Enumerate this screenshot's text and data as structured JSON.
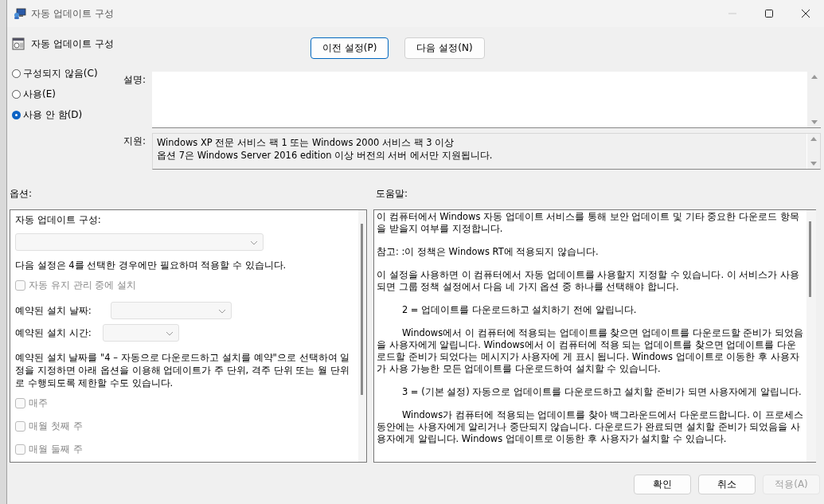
{
  "window": {
    "title": "자동 업데이트 구성",
    "controls": [
      {
        "kind": "minimize",
        "disabled": true
      },
      {
        "kind": "maximize",
        "disabled": false
      },
      {
        "kind": "close",
        "disabled": false
      }
    ]
  },
  "header": {
    "title": "자동 업데이트 구성"
  },
  "nav_buttons": [
    {
      "label": "이전 설정(P)",
      "focused": true
    },
    {
      "label": "다음 설정(N)",
      "focused": false
    }
  ],
  "state_options": [
    {
      "label": "구성되지 않음(C)",
      "selected": false
    },
    {
      "label": "사용(E)",
      "selected": false
    },
    {
      "label": "사용 안 함(D)",
      "selected": true
    }
  ],
  "description": {
    "label": "설명:"
  },
  "support": {
    "label": "지원:",
    "lines": [
      "Windows XP 전문 서비스 팩 1 또는 Windows 2000 서비스 팩 3 이상",
      "옵션 7은 Windows Server 2016 edition 이상 버전의 서버 에서만 지원됩니다."
    ]
  },
  "options": {
    "label": "옵션:",
    "items": [
      {
        "kind": "label",
        "text": "자동 업데이트 구성:"
      },
      {
        "kind": "dropdown",
        "disabled": true
      },
      {
        "kind": "text",
        "text": "다음 설정은 4를 선택한 경우에만 필요하며 적용할 수 있습니다."
      },
      {
        "kind": "checkbox",
        "label": "자동 유지 관리 중에 설치",
        "checked": false,
        "disabled": true
      },
      {
        "kind": "labeled_dropdown",
        "label": "예약된 설치 날짜:",
        "disabled": true
      },
      {
        "kind": "labeled_dropdown",
        "label": "예약된 설치 시간:",
        "disabled": true
      },
      {
        "kind": "text",
        "text": "예약된 설치 날짜를 \"4 – 자동으로 다운로드하고 설치를 예약\"으로 선택하여 일정을 지정하면 아래 옵션을 이용해 업데이트가 주 단위, 격주 단위 또는 월 단위로 수행되도록 제한할 수도 있습니다."
      },
      {
        "kind": "checkbox",
        "label": "매주",
        "checked": false,
        "disabled": true
      },
      {
        "kind": "checkbox",
        "label": "매월 첫째 주",
        "checked": false,
        "disabled": true
      },
      {
        "kind": "checkbox",
        "label": "매월 둘째 주",
        "checked": false,
        "disabled": true
      }
    ]
  },
  "help": {
    "label": "도움말:",
    "paragraphs": [
      {
        "kind": "plain",
        "text": "이 컴퓨터에서 Windows 자동 업데이트 서비스를 통해 보안 업데이트 및 기타 중요한 다운로드 항목을 받을지 여부를 지정합니다."
      },
      {
        "kind": "plain",
        "text": "참고: :이 정책은 Windows RT에 적용되지 않습니다."
      },
      {
        "kind": "plain",
        "text": "이 설정을 사용하면 이 컴퓨터에서 자동 업데이트를 사용할지 지정할 수 있습니다. 이 서비스가 사용되면 그룹 정책 설정에서 다음 네 가지 옵션 중 하나를 선택해야 합니다."
      },
      {
        "kind": "indented",
        "text": "2 = 업데이트를 다운로드하고 설치하기 전에 알립니다."
      },
      {
        "kind": "indented",
        "text": "Windows에서 이 컴퓨터에 적용되는 업데이트를 찾으면 업데이트를 다운로드할 준비가 되었음을 사용자에게 알립니다. Windows에서 이 컴퓨터에 적용 되는 업데이트를 찾으면 업데이트를 다운로드할 준비가 되었다는 메시지가 사용자에 게 표시 됩니다. Windows 업데이트로 이동한 후 사용자가 사용 가능한 모든 업데이트를 다운로드하여 설치할 수 있습니다."
      },
      {
        "kind": "indented",
        "text": "3 = (기본 설정) 자동으로 업데이트를 다운로드하고 설치할 준비가 되면 사용자에게 알립니다."
      },
      {
        "kind": "indented",
        "text": "Windows가 컴퓨터에 적용되는 업데이트를 찾아 백그라운드에서 다운로드합니다. 이 프로세스 동안에는 사용자에게 알리거나 중단되지 않습니다. 다운로드가 완료되면 설치할 준비가 되었음을 사용자에게 알립니다. Windows 업데이트로 이동한 후 사용자가 설치할 수 있습니다."
      }
    ]
  },
  "dialog_buttons": [
    {
      "label": "확인",
      "disabled": false
    },
    {
      "label": "취소",
      "disabled": false
    },
    {
      "label": "적용(A)",
      "disabled": true
    }
  ]
}
